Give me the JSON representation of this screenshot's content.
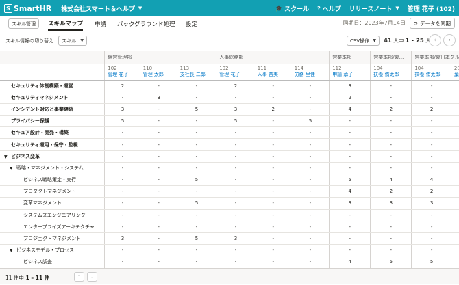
{
  "header": {
    "logo_text": "SmartHR",
    "company": "株式会社スマート＆ヘルプ",
    "school": "スクール",
    "help": "ヘルプ",
    "release_notes": "リリースノート",
    "user": "管理 花子 (102)"
  },
  "tabs": {
    "skill_admin": "スキル管理",
    "items": [
      "スキルマップ",
      "申請",
      "バックグラウンド処理",
      "設定"
    ],
    "active": "スキルマップ",
    "sync_date": "同期日：2023年7月14日",
    "sync_button": "データを同期"
  },
  "toolbar": {
    "switch_label": "スキル情報の切り替え",
    "switch_value": "スキル",
    "csv_label": "CSV操作",
    "pager_total": "41",
    "pager_text_a": " 人中 ",
    "pager_range": "1 - 25",
    "pager_text_b": " 人"
  },
  "groups": [
    {
      "label": "経営管理部",
      "span": 3
    },
    {
      "label": "人事総務部",
      "span": 3
    },
    {
      "label": "営業本部",
      "span": 1
    },
    {
      "label": "営業本部/東...",
      "span": 1
    },
    {
      "label": "営業本部/東日本グループ",
      "span": 2
    }
  ],
  "employees": [
    {
      "code": "102",
      "name": "管理 花子"
    },
    {
      "code": "110",
      "name": "管理 太郎"
    },
    {
      "code": "113",
      "name": "支社長 二郎"
    },
    {
      "code": "102",
      "name": "管理 花子"
    },
    {
      "code": "111",
      "name": "人事 杏美"
    },
    {
      "code": "114",
      "name": "労務 里佳"
    },
    {
      "code": "112",
      "name": "申請 承子"
    },
    {
      "code": "104",
      "name": "扶養 侑太郎"
    },
    {
      "code": "104",
      "name": "扶養 侑太郎"
    },
    {
      "code": "203",
      "name": "葉月 美"
    }
  ],
  "rows": [
    {
      "label": "セキュリティ体制構築・運営",
      "level": "l0",
      "values": [
        "2",
        "-",
        "-",
        "2",
        "-",
        "-",
        "3",
        "-",
        "-",
        "-"
      ]
    },
    {
      "label": "セキュリティマネジメント",
      "level": "l0",
      "values": [
        "-",
        "3",
        "-",
        "-",
        "-",
        "-",
        "2",
        "-",
        "-",
        "-"
      ]
    },
    {
      "label": "インシデント対応と事業継続",
      "level": "l0",
      "values": [
        "3",
        "-",
        "5",
        "3",
        "2",
        "-",
        "4",
        "2",
        "2",
        "-"
      ]
    },
    {
      "label": "プライバシー保護",
      "level": "l0",
      "values": [
        "5",
        "-",
        "-",
        "5",
        "-",
        "5",
        "-",
        "-",
        "-",
        "-"
      ]
    },
    {
      "label": "セキュア設計・開発・構築",
      "level": "l0",
      "values": [
        "-",
        "-",
        "-",
        "-",
        "-",
        "-",
        "-",
        "-",
        "-",
        "-"
      ]
    },
    {
      "label": "セキュリティ運用・保守・監視",
      "level": "l0",
      "values": [
        "-",
        "-",
        "-",
        "-",
        "-",
        "-",
        "-",
        "-",
        "-",
        "-"
      ]
    },
    {
      "label": "ビジネス変革",
      "level": "cat",
      "values": [
        "-",
        "-",
        "-",
        "-",
        "-",
        "-",
        "-",
        "-",
        "-",
        "-"
      ]
    },
    {
      "label": "戦略・マネジメント・システム",
      "level": "l2",
      "tri": true,
      "values": [
        "-",
        "-",
        "-",
        "-",
        "-",
        "-",
        "-",
        "-",
        "-",
        "-"
      ]
    },
    {
      "label": "ビジネス戦略策定・実行",
      "level": "l3",
      "values": [
        "-",
        "-",
        "5",
        "-",
        "-",
        "-",
        "5",
        "4",
        "4",
        "-"
      ]
    },
    {
      "label": "プロダクトマネジメント",
      "level": "l3",
      "values": [
        "-",
        "-",
        "-",
        "-",
        "-",
        "-",
        "4",
        "2",
        "2",
        "-"
      ]
    },
    {
      "label": "変革マネジメント",
      "level": "l3",
      "values": [
        "-",
        "-",
        "5",
        "-",
        "-",
        "-",
        "3",
        "3",
        "3",
        "-"
      ]
    },
    {
      "label": "システムズエンジニアリング",
      "level": "l3",
      "values": [
        "-",
        "-",
        "-",
        "-",
        "-",
        "-",
        "-",
        "-",
        "-",
        "-"
      ]
    },
    {
      "label": "エンタープライズアーキテクチャ",
      "level": "l3",
      "values": [
        "-",
        "-",
        "-",
        "-",
        "-",
        "-",
        "-",
        "-",
        "-",
        "-"
      ]
    },
    {
      "label": "プロジェクトマネジメント",
      "level": "l3",
      "values": [
        "3",
        "-",
        "5",
        "3",
        "-",
        "-",
        "-",
        "-",
        "-",
        "-"
      ]
    },
    {
      "label": "ビジネスモデル・プロセス",
      "level": "l2",
      "tri": true,
      "values": [
        "-",
        "-",
        "-",
        "-",
        "-",
        "-",
        "-",
        "-",
        "-",
        "-"
      ]
    },
    {
      "label": "ビジネス調査",
      "level": "l3",
      "values": [
        "-",
        "-",
        "-",
        "-",
        "-",
        "-",
        "4",
        "5",
        "5",
        "-"
      ]
    }
  ],
  "footer": {
    "count": "11 件中",
    "range": "1 – 11 件"
  }
}
